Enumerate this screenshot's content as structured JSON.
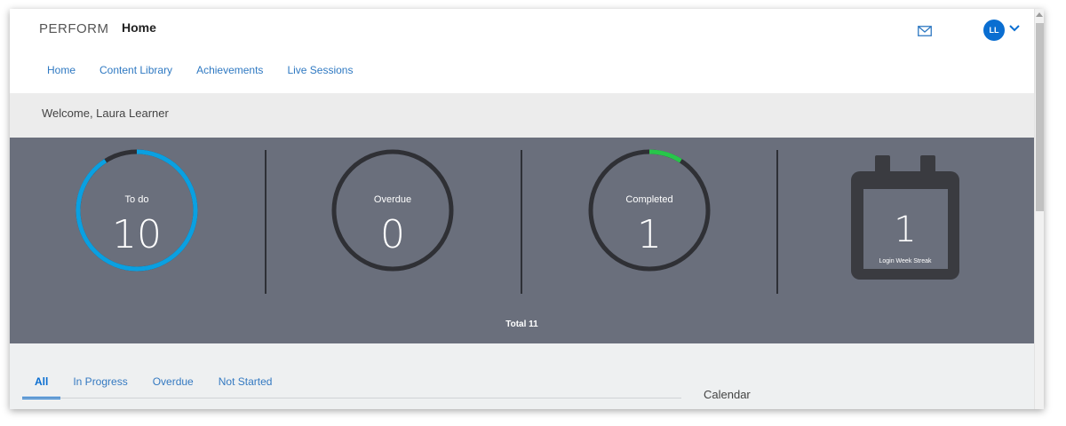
{
  "header": {
    "logo": "PERFORM",
    "title": "Home",
    "avatar_initials": "LL"
  },
  "nav": {
    "items": [
      "Home",
      "Content Library",
      "Achievements",
      "Live Sessions"
    ]
  },
  "welcome": "Welcome, Laura Learner",
  "stats": {
    "todo": {
      "label": "To do",
      "value": "10",
      "progress": 0.91,
      "color": "#0aa0e1"
    },
    "overdue": {
      "label": "Overdue",
      "value": "0",
      "progress": 0
    },
    "completed": {
      "label": "Completed",
      "value": "1",
      "progress": 0.09,
      "color": "#27c64a"
    },
    "streak": {
      "value": "1",
      "label": "Login Week Streak"
    },
    "total": "Total 11",
    "ring_track_color": "#2f3035"
  },
  "tabs": [
    "All",
    "In Progress",
    "Overdue",
    "Not Started"
  ],
  "active_tab": "All",
  "calendar_title": "Calendar",
  "colors": {
    "accent": "#0a6ed1",
    "link": "#2f79c2",
    "stats_bg": "#6a6f7c"
  }
}
